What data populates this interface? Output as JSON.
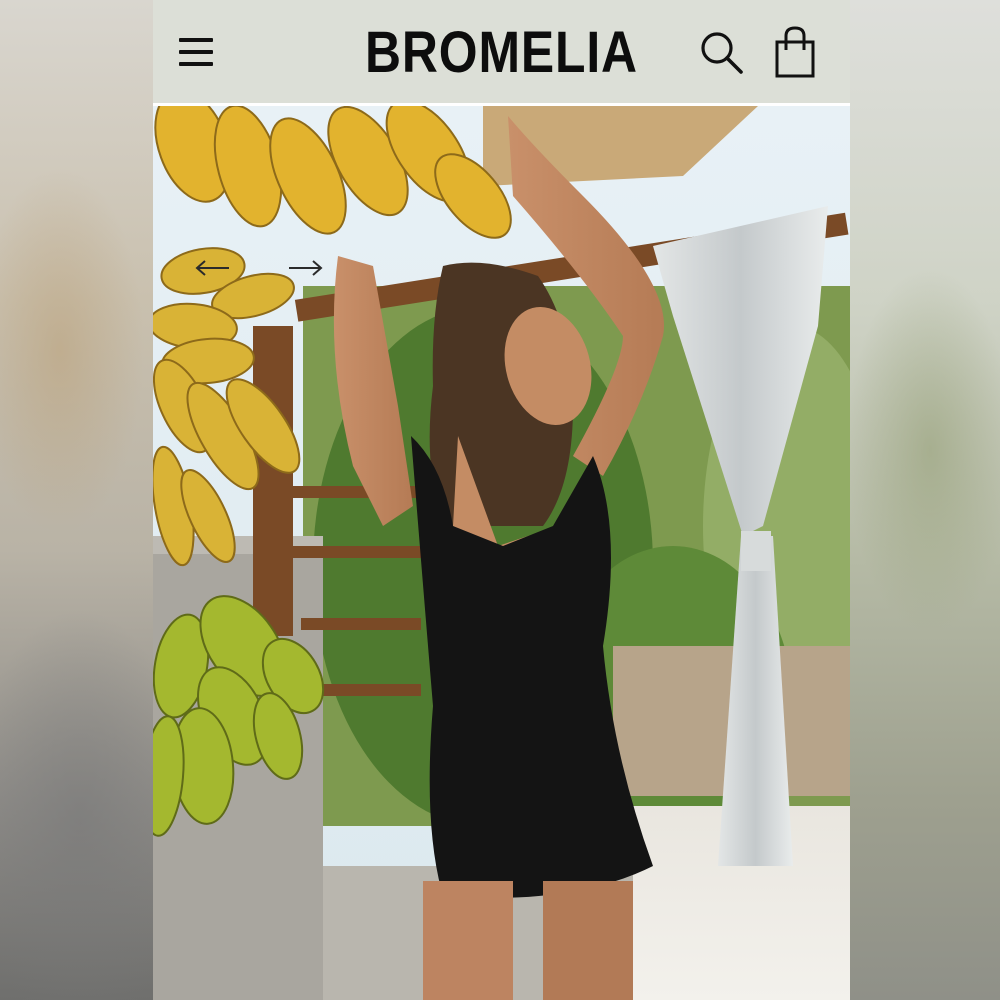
{
  "header": {
    "brand": "BROMELIA",
    "menu_icon": "hamburger-menu-icon",
    "search_icon": "search-icon",
    "bag_icon": "shopping-bag-icon"
  },
  "hero": {
    "image": "model-in-black-dress-under-banana-pergola",
    "prev_icon": "arrow-left-icon",
    "next_icon": "arrow-right-icon"
  },
  "colors": {
    "header_bg": "#dcdfd7",
    "brand_text": "#0d0d0d",
    "page_bg": "#ffffff"
  }
}
